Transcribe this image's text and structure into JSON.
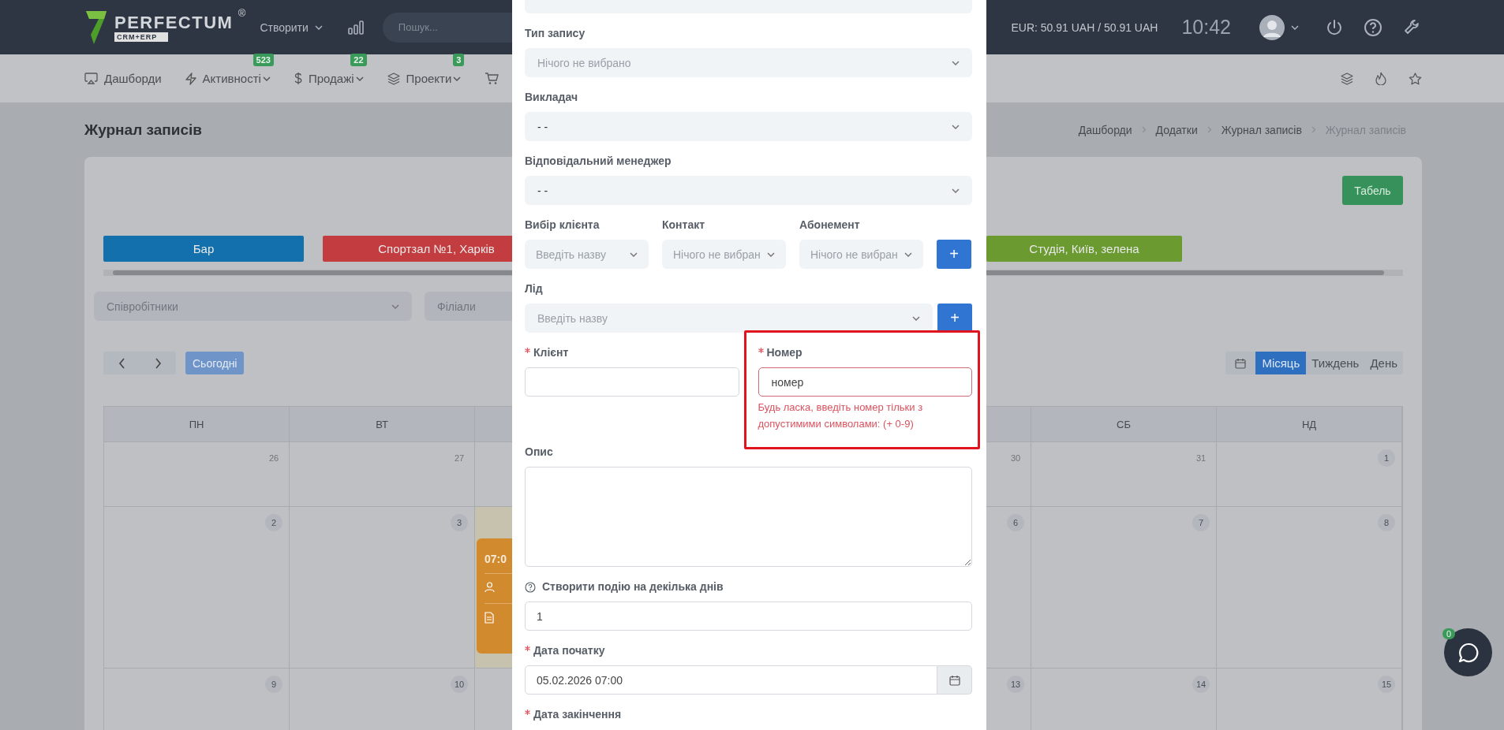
{
  "top_bar": {
    "logo": {
      "name": "PERFECTUM",
      "mark": "®",
      "tagline": "CRM+ERP"
    },
    "create_menu": "Створити",
    "search": {
      "placeholder": "Пошук..."
    },
    "currency": "EUR: 50.91 UAH / 50.91 UAH",
    "clock": "10:42"
  },
  "nav": {
    "items": [
      {
        "label": "Дашборди",
        "dropdown": false
      },
      {
        "label": "Активності",
        "badge": "523",
        "dropdown": true
      },
      {
        "label": "Продажі",
        "badge": "22",
        "dropdown": true
      },
      {
        "label": "Проекти",
        "badge": "3",
        "dropdown": true
      }
    ]
  },
  "page": {
    "title": "Журнал записів",
    "breadcrumb": [
      {
        "label": "Дашборди",
        "current": false
      },
      {
        "label": "Додатки",
        "current": false
      },
      {
        "label": "Журнал записів",
        "current": false
      },
      {
        "label": "Журнал записів",
        "current": true
      }
    ],
    "timesheet_button": "Табель",
    "resources": [
      {
        "label": "Бар",
        "color": "#1470ac"
      },
      {
        "label": "Спортзал №1, Харків",
        "color": "#c23c40"
      },
      {
        "label": "Студія, Київ, зелена",
        "color": "#6a9a30"
      }
    ],
    "filters": [
      {
        "placeholder": "Співробітники"
      },
      {
        "placeholder": "Філіали"
      }
    ],
    "today_button": "Сьогодні",
    "views": [
      {
        "label": "Місяць",
        "selected": true
      },
      {
        "label": "Тиждень",
        "selected": false
      },
      {
        "label": "День",
        "selected": false
      }
    ],
    "calendar": {
      "columns": [
        {
          "label": "ПН"
        },
        {
          "label": "ВТ"
        },
        {
          "label": "СБ"
        },
        {
          "label": "НД"
        }
      ],
      "weeks": [
        [
          {
            "date": "26",
            "muted": true,
            "today": false
          },
          {
            "date": "27",
            "muted": true,
            "today": false
          },
          {
            "date": "30",
            "muted": true,
            "today": false
          },
          {
            "date": "31",
            "muted": true,
            "today": false
          },
          {
            "date": "1",
            "muted": false,
            "today": false
          }
        ],
        [
          {
            "date": "2",
            "muted": false,
            "today": false
          },
          {
            "date": "3",
            "muted": false,
            "today": false
          },
          {
            "today": true,
            "event": {
              "time": "07:0"
            }
          },
          {
            "date": "6",
            "muted": false,
            "today": false
          },
          {
            "date": "7",
            "muted": false,
            "today": false
          },
          {
            "date": "8",
            "muted": false,
            "today": false
          }
        ],
        [
          {
            "date": "9",
            "muted": false,
            "today": false
          },
          {
            "date": "10",
            "muted": false,
            "today": false
          },
          {
            "date": "13",
            "muted": false,
            "today": false
          },
          {
            "date": "14",
            "muted": false,
            "today": false
          },
          {
            "date": "15",
            "muted": false,
            "today": false
          }
        ]
      ]
    }
  },
  "modal": {
    "record_type": {
      "label": "Тип запису",
      "placeholder": "Нічого не вибрано"
    },
    "teacher": {
      "label": "Викладач",
      "value": "- -"
    },
    "manager": {
      "label": "Відповідальний менеджер",
      "value": "- -"
    },
    "client_select": {
      "label": "Вибір клієнта",
      "placeholder": "Введіть назву"
    },
    "contact": {
      "label": "Контакт",
      "placeholder": "Нічого не вибран"
    },
    "subscription": {
      "label": "Абонемент",
      "placeholder": "Нічого не вибран"
    },
    "add_subscription": "+",
    "lead": {
      "label": "Лід",
      "placeholder": "Введіть назву"
    },
    "add_lead": "+",
    "client": {
      "label": "Клієнт",
      "required": true
    },
    "number": {
      "label": "Номер",
      "required": true,
      "value": "номер",
      "invalid": true,
      "highlighted": true,
      "error": "Будь ласка, введіть номер тільки з допустимими символами: (+ 0-9)"
    },
    "description": {
      "label": "Опис"
    },
    "multi_day": {
      "label": "Створити подію на декілька днів",
      "value": "1"
    },
    "start_date": {
      "label": "Дата початку",
      "required": true,
      "value": "05.02.2026 07:00"
    },
    "end_date": {
      "label": "Дата закінчення",
      "required": true
    }
  },
  "chat": {
    "badge": "0"
  }
}
